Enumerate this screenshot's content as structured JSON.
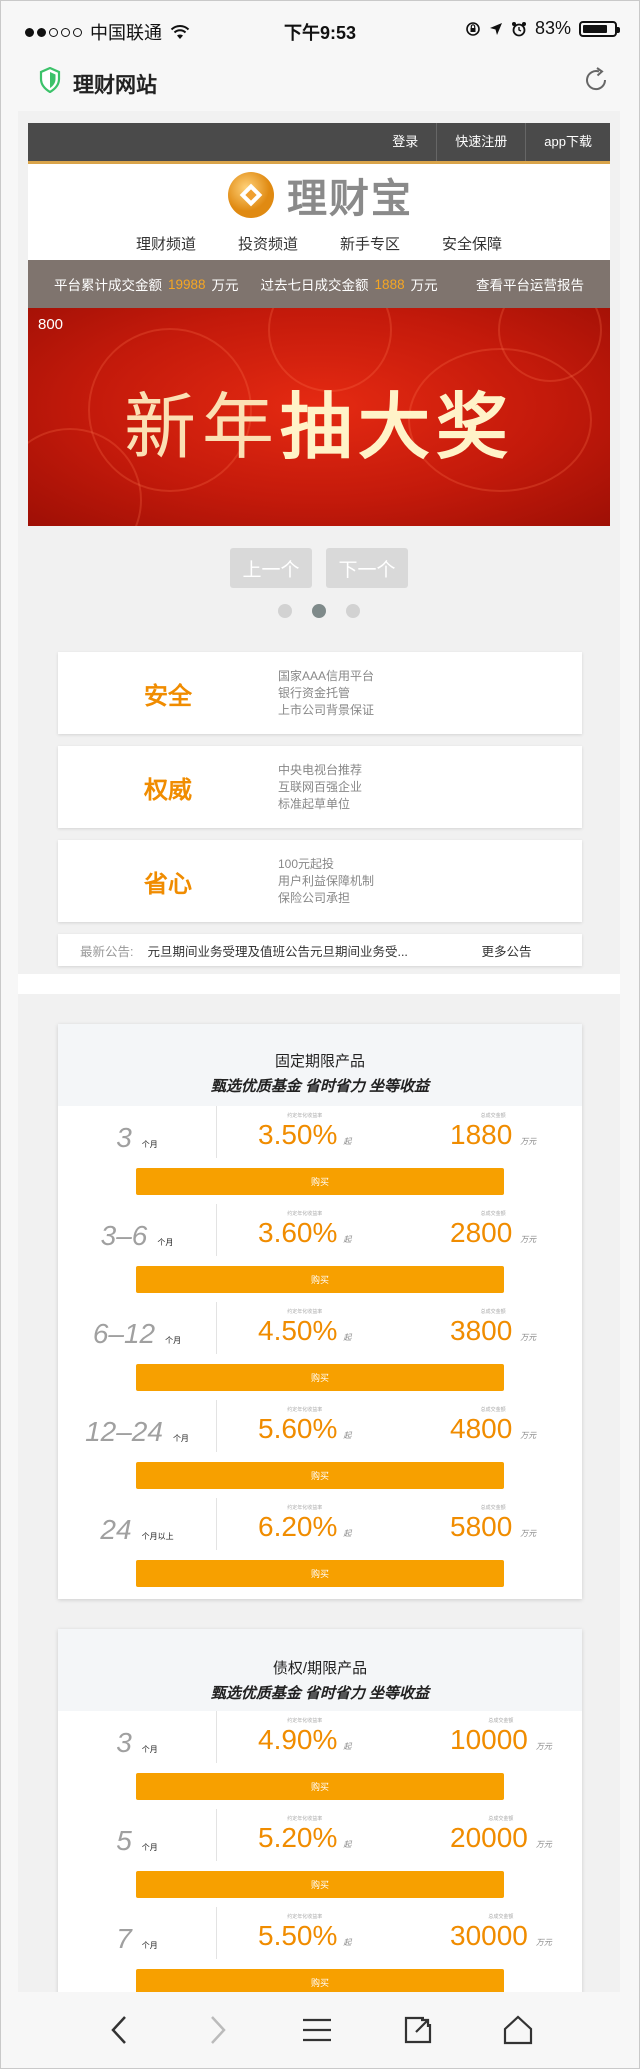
{
  "status": {
    "carrier": "中国联通",
    "time": "下午9:53",
    "battery": "83%",
    "battery_level": 0.83
  },
  "browser": {
    "site_title": "理财网站"
  },
  "topnav": {
    "login": "登录",
    "register": "快速注册",
    "app": "app下载"
  },
  "logo": {
    "text": "理财宝"
  },
  "mainnav": [
    "理财频道",
    "投资频道",
    "新手专区",
    "安全保障"
  ],
  "stats": {
    "label1": "平台累计成交金额",
    "value1": "19988",
    "unit1": "万元",
    "label2": "过去七日成交金额",
    "value2": "1888",
    "unit2": "万元",
    "report": "查看平台运营报告"
  },
  "banner": {
    "corner": "800",
    "title_light": "新年",
    "title_bold": "抽大奖"
  },
  "carousel": {
    "prev": "上一个",
    "next": "下一个"
  },
  "features": [
    {
      "title": "安全",
      "lines": [
        "国家AAA信用平台",
        "银行资金托管",
        "上市公司背景保证"
      ]
    },
    {
      "title": "权威",
      "lines": [
        "中央电视台推荐",
        "互联网百强企业",
        "标准起草单位"
      ]
    },
    {
      "title": "省心",
      "lines": [
        "100元起投",
        "用户利益保障机制",
        "保险公司承担"
      ]
    }
  ],
  "notice": {
    "label": "最新公告:",
    "text": "元旦期间业务受理及值班公告元旦期间业务受...",
    "more": "更多公告"
  },
  "sections": [
    {
      "title": "固定期限产品",
      "subtitle": "甄选优质基金 省时省力 坐等收益",
      "products": [
        {
          "term": "3",
          "term_unit": "个月",
          "rate_caption": "约定年化收益率",
          "rate": "3.50%",
          "rate_unit": "起",
          "amount_caption": "总成交金额",
          "amount": "1880",
          "amount_unit": "万元",
          "buy": "购买"
        },
        {
          "term": "3–6",
          "term_unit": "个月",
          "rate_caption": "约定年化收益率",
          "rate": "3.60%",
          "rate_unit": "起",
          "amount_caption": "总成交金额",
          "amount": "2800",
          "amount_unit": "万元",
          "buy": "购买"
        },
        {
          "term": "6–12",
          "term_unit": "个月",
          "rate_caption": "约定年化收益率",
          "rate": "4.50%",
          "rate_unit": "起",
          "amount_caption": "总成交金额",
          "amount": "3800",
          "amount_unit": "万元",
          "buy": "购买"
        },
        {
          "term": "12–24",
          "term_unit": "个月",
          "rate_caption": "约定年化收益率",
          "rate": "5.60%",
          "rate_unit": "起",
          "amount_caption": "总成交金额",
          "amount": "4800",
          "amount_unit": "万元",
          "buy": "购买"
        },
        {
          "term": "24",
          "term_unit": "个月以上",
          "rate_caption": "约定年化收益率",
          "rate": "6.20%",
          "rate_unit": "起",
          "amount_caption": "总成交金额",
          "amount": "5800",
          "amount_unit": "万元",
          "buy": "购买"
        }
      ]
    },
    {
      "title": "债权/期限产品",
      "subtitle": "甄选优质基金 省时省力 坐等收益",
      "products": [
        {
          "term": "3",
          "term_unit": "个月",
          "rate_caption": "约定年化收益率",
          "rate": "4.90%",
          "rate_unit": "起",
          "amount_caption": "总成交金额",
          "amount": "10000",
          "amount_unit": "万元",
          "buy": "购买"
        },
        {
          "term": "5",
          "term_unit": "个月",
          "rate_caption": "约定年化收益率",
          "rate": "5.20%",
          "rate_unit": "起",
          "amount_caption": "总成交金额",
          "amount": "20000",
          "amount_unit": "万元",
          "buy": "购买"
        },
        {
          "term": "7",
          "term_unit": "个月",
          "rate_caption": "约定年化收益率",
          "rate": "5.50%",
          "rate_unit": "起",
          "amount_caption": "总成交金额",
          "amount": "30000",
          "amount_unit": "万元",
          "buy": "购买"
        }
      ]
    }
  ],
  "colors": {
    "accent": "#f08c00",
    "button": "#f7a000",
    "nav_bg": "#4a4a4a",
    "stats_bg": "#7f746e",
    "banner": "#c41a0b"
  },
  "icons": {
    "shield": "shield-icon",
    "reload": "reload-icon",
    "back": "back-icon",
    "forward": "forward-icon",
    "menu": "menu-icon",
    "share": "share-icon",
    "home": "home-icon"
  }
}
